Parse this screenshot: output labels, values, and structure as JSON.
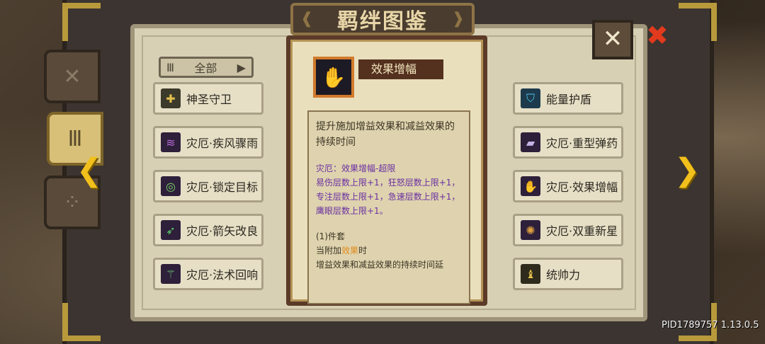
{
  "title": "羁绊图鉴",
  "filter": {
    "label": "全部"
  },
  "tooltip": {
    "name": "效果增幅",
    "description": "提升施加增益效果和减益效果的持续时间",
    "bonus_title": "灾厄：效果增幅-超限",
    "bonus_lines": [
      "易伤层数上限+1，狂怒层数上限+1，",
      "专注层数上限+1，急速层数上限+1，",
      "鹰眼层数上限+1。"
    ],
    "set_title": "(1)件套",
    "set_trigger_pre": "当附加",
    "set_trigger_hl": "效果",
    "set_trigger_post": "时",
    "set_effect": "增益效果和减益效果的持续时间延"
  },
  "entries_left": [
    {
      "label": "神圣守卫",
      "icon": "shield-cross-icon"
    },
    {
      "label": "灾厄·疾风骤雨",
      "icon": "storm-icon"
    },
    {
      "label": "灾厄·锁定目标",
      "icon": "target-icon"
    },
    {
      "label": "灾厄·箭矢改良",
      "icon": "arrow-icon"
    },
    {
      "label": "灾厄·法术回响",
      "icon": "staff-icon"
    }
  ],
  "entries_right": [
    {
      "label": "能量护盾",
      "icon": "energy-shield-icon"
    },
    {
      "label": "灾厄·重型弹药",
      "icon": "ammo-icon"
    },
    {
      "label": "灾厄·效果增幅",
      "icon": "praying-hands-icon"
    },
    {
      "label": "灾厄·双重新星",
      "icon": "nova-icon"
    },
    {
      "label": "统帅力",
      "icon": "chess-icon"
    }
  ],
  "version": "PID1789757 1.13.0.5",
  "colors": {
    "gold": "#f2c01c",
    "close_red": "#e23a1e",
    "purple_text": "#6a2ea2",
    "highlight": "#e08a1c"
  }
}
